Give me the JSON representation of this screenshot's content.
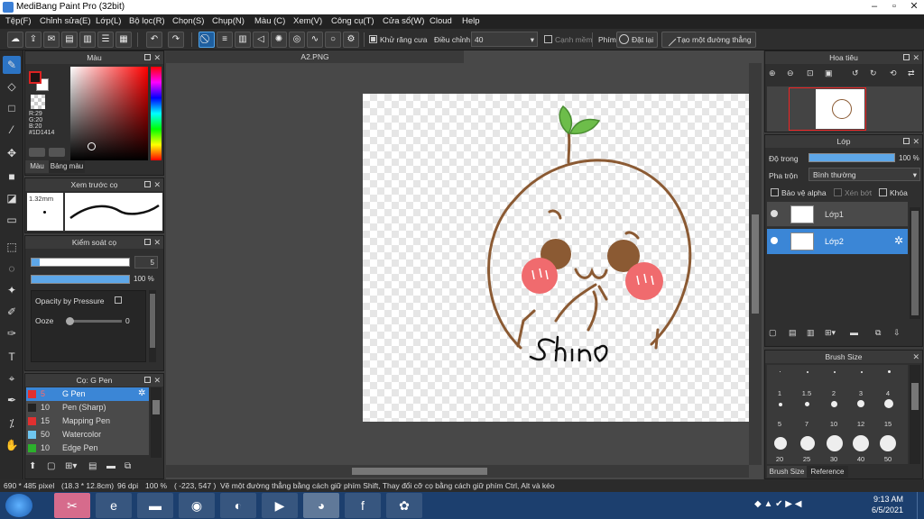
{
  "window": {
    "title": "MediBang Paint Pro (32bit)"
  },
  "menu": [
    "Tệp(F)",
    "Chỉnh sửa(E)",
    "Lớp(L)",
    "Bộ lọc(R)",
    "Chọn(S)",
    "Chụp(N)",
    "Màu (C)",
    "Xem(V)",
    "Công cụ(T)",
    "Cửa sổ(W)",
    "Cloud",
    "Help"
  ],
  "toolbar": {
    "anti_alias_label": "Khử răng cưa",
    "adjust_label": "Điều chỉnh",
    "adjust_value": "40",
    "edge_label": "Cạnh mềm",
    "key_label": "Phím",
    "reset_label": "Đặt lại",
    "make_line_label": "Tạo một đường thẳng"
  },
  "color_panel": {
    "title": "Màu",
    "r": "R:29",
    "g": "G:20",
    "b": "B:20",
    "hex": "#1D1414",
    "tab_color": "Màu",
    "tab_palette": "Bảng màu",
    "fg_color": "#1D1414",
    "bg_color": "#ffffff"
  },
  "brush_preview": {
    "title": "Xem trước cọ",
    "size": "1.32mm"
  },
  "brush_control": {
    "title": "Kiểm soát cọ",
    "size_value": "5",
    "opacity_value": "100 %",
    "opacity_fraction": 1.0,
    "pressure_label": "Opacity by Pressure",
    "ooze_label": "Ooze",
    "ooze_value": "0"
  },
  "brush_list": {
    "title": "Cọ: G Pen",
    "items": [
      {
        "size": "5",
        "name": "G Pen",
        "color": "#e03030",
        "selected": true
      },
      {
        "size": "10",
        "name": "Pen (Sharp)",
        "color": "#222222",
        "selected": false
      },
      {
        "size": "15",
        "name": "Mapping Pen",
        "color": "#e03030",
        "selected": false
      },
      {
        "size": "50",
        "name": "Watercolor",
        "color": "#6ec6f0",
        "selected": false
      },
      {
        "size": "10",
        "name": "Edge Pen",
        "color": "#2cb02c",
        "selected": false
      }
    ]
  },
  "document": {
    "tab": "A2.PNG",
    "signature": "Shin"
  },
  "navigator": {
    "title": "Hoa tiêu"
  },
  "layer_panel": {
    "title": "Lớp",
    "opacity_label": "Độ trong",
    "opacity_value": "100 %",
    "blend_label": "Pha trộn",
    "blend_value": "Bình thường",
    "protect_alpha": "Bảo vệ alpha",
    "clipping": "Xén bớt",
    "lock": "Khóa",
    "layers": [
      {
        "name": "Lớp1",
        "selected": false
      },
      {
        "name": "Lớp2",
        "selected": true
      }
    ]
  },
  "brush_size_panel": {
    "title": "Brush Size",
    "sizes_row1": [
      "1",
      "1.5",
      "2",
      "3",
      "4"
    ],
    "sizes_row2": [
      "5",
      "7",
      "10",
      "12",
      "15"
    ],
    "sizes_row3": [
      "20",
      "25",
      "30",
      "40",
      "50"
    ],
    "tab_size": "Brush Size",
    "tab_reference": "Reference"
  },
  "status": {
    "dimensions": "690 * 485 pixel",
    "size_cm": "(18.3 * 12.8cm)",
    "dpi": "96 dpi",
    "zoom": "100 %",
    "coords": "( -223, 547 )",
    "hint": "Vẽ một đường thẳng bằng cách giữ phím Shift, Thay đổi cỡ cọ bằng cách giữ phím Ctrl, Alt và kéo"
  },
  "taskbar": {
    "time": "9:13 AM",
    "date": "6/5/2021"
  }
}
